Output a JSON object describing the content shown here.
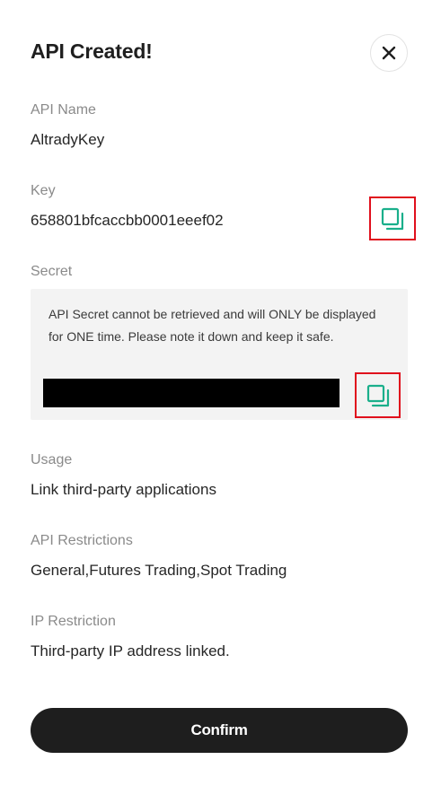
{
  "dialog": {
    "title": "API Created!",
    "close_icon": "close-icon"
  },
  "fields": {
    "api_name": {
      "label": "API Name",
      "value": "AltradyKey"
    },
    "key": {
      "label": "Key",
      "value": "658801bfcaccbb0001eeef02",
      "copy_icon": "copy-icon"
    },
    "secret": {
      "label": "Secret",
      "note": "API Secret cannot be retrieved and will ONLY be displayed for ONE time. Please note it down and keep it safe.",
      "value_redacted": true,
      "copy_icon": "copy-icon"
    },
    "usage": {
      "label": "Usage",
      "value": "Link third-party applications"
    },
    "api_restrictions": {
      "label": "API Restrictions",
      "value": "General,Futures Trading,Spot Trading"
    },
    "ip_restriction": {
      "label": "IP Restriction",
      "value": "Third-party IP address linked."
    }
  },
  "actions": {
    "confirm_label": "Confirm"
  },
  "colors": {
    "accent_icon": "#1aaf8b",
    "highlight_box": "#e0101d",
    "primary_button": "#1e1e1e"
  }
}
